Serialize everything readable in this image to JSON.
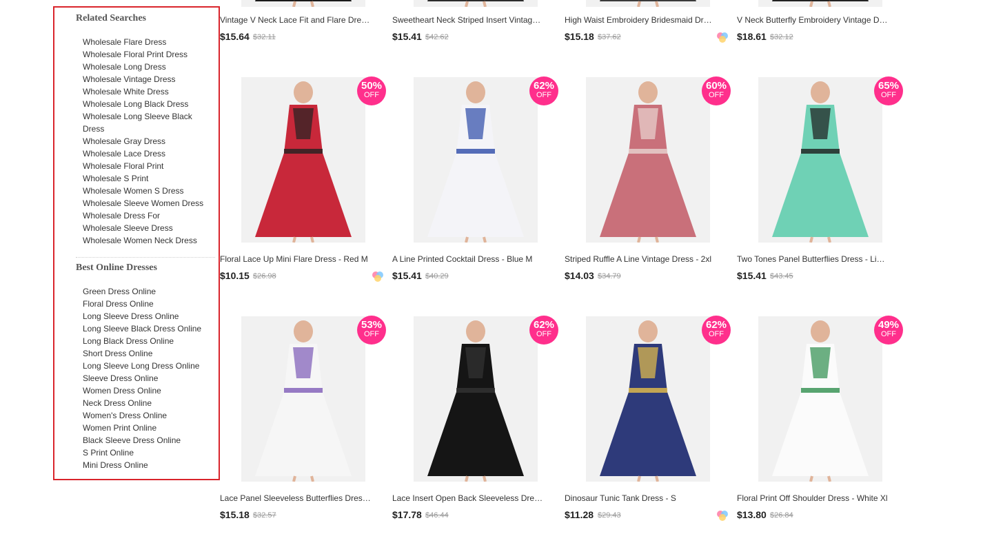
{
  "sidebar": {
    "related_title": "Related Searches",
    "related": [
      "Wholesale Flare Dress",
      "Wholesale Floral Print Dress",
      "Wholesale Long Dress",
      "Wholesale Vintage Dress",
      "Wholesale White Dress",
      "Wholesale Long Black Dress",
      "Wholesale Long Sleeve Black Dress",
      "Wholesale Gray Dress",
      "Wholesale Lace Dress",
      "Wholesale Floral Print",
      "Wholesale S Print",
      "Wholesale Women S Dress",
      "Wholesale Sleeve Women Dress",
      "Wholesale Dress For",
      "Wholesale Sleeve Dress",
      "Wholesale Women Neck Dress"
    ],
    "best_title": "Best Online Dresses",
    "best": [
      "Green Dress Online",
      "Floral Dress Online",
      "Long Sleeve Dress Online",
      "Long Sleeve Black Dress Online",
      "Long Black Dress Online",
      "Short Dress Online",
      "Long Sleeve Long Dress Online",
      "Sleeve Dress Online",
      "Women Dress Online",
      "Neck Dress Online",
      "Women's Dress Online",
      "Women Print Online",
      "Black Sleeve Dress Online",
      "S Print Online",
      "Mini Dress Online"
    ]
  },
  "products": [
    {
      "name": "Vintage V Neck Lace Fit and Flare Dress - Black",
      "price": "$15.64",
      "old": "$32.11",
      "discount": "",
      "off": "",
      "swatch": false,
      "color": "#1a1a1a",
      "accent": "#333"
    },
    {
      "name": "Sweetheart Neck Striped Insert Vintage Dress",
      "price": "$15.41",
      "old": "$42.62",
      "discount": "",
      "off": "",
      "swatch": false,
      "color": "#2b2b2b",
      "accent": "#444"
    },
    {
      "name": "High Waist Embroidery Bridesmaid Dress",
      "price": "$15.18",
      "old": "$37.62",
      "discount": "",
      "off": "",
      "swatch": true,
      "color": "#3a3a3a",
      "accent": "#555"
    },
    {
      "name": "V Neck Butterfly Embroidery Vintage Dress",
      "price": "$18.61",
      "old": "$32.12",
      "discount": "",
      "off": "",
      "swatch": false,
      "color": "#222",
      "accent": "#444"
    },
    {
      "name": "Floral Lace Up Mini Flare Dress - Red M",
      "price": "$10.15",
      "old": "$26.98",
      "discount": "50%",
      "off": "OFF",
      "swatch": true,
      "color": "#c8283a",
      "accent": "#222"
    },
    {
      "name": "A Line Printed Cocktail Dress - Blue M",
      "price": "$15.41",
      "old": "$40.29",
      "discount": "62%",
      "off": "OFF",
      "swatch": false,
      "color": "#f4f4f8",
      "accent": "#2c4aa8"
    },
    {
      "name": "Striped Ruffle A Line Vintage Dress - 2xl",
      "price": "$14.03",
      "old": "$34.79",
      "discount": "60%",
      "off": "OFF",
      "swatch": false,
      "color": "#c9707a",
      "accent": "#e9d6d2"
    },
    {
      "name": "Two Tones Panel Butterflies Dress - Light Green",
      "price": "$15.41",
      "old": "$43.45",
      "discount": "65%",
      "off": "OFF",
      "swatch": false,
      "color": "#6fd1b5",
      "accent": "#1d1d1d"
    },
    {
      "name": "Lace Panel Sleeveless Butterflies Dress - White",
      "price": "$15.18",
      "old": "$32.57",
      "discount": "53%",
      "off": "OFF",
      "swatch": false,
      "color": "#f6f6f6",
      "accent": "#7e5bb8"
    },
    {
      "name": "Lace Insert Open Back Sleeveless Dress - Black",
      "price": "$17.78",
      "old": "$46.44",
      "discount": "62%",
      "off": "OFF",
      "swatch": false,
      "color": "#151515",
      "accent": "#333"
    },
    {
      "name": "Dinosaur Tunic Tank Dress - S",
      "price": "$11.28",
      "old": "$29.43",
      "discount": "62%",
      "off": "OFF",
      "swatch": true,
      "color": "#2e3a7a",
      "accent": "#e8c04a"
    },
    {
      "name": "Floral Print Off Shoulder Dress - White Xl",
      "price": "$13.80",
      "old": "$26.84",
      "discount": "49%",
      "off": "OFF",
      "swatch": false,
      "color": "#fbfbfb",
      "accent": "#2f8f4e"
    }
  ]
}
